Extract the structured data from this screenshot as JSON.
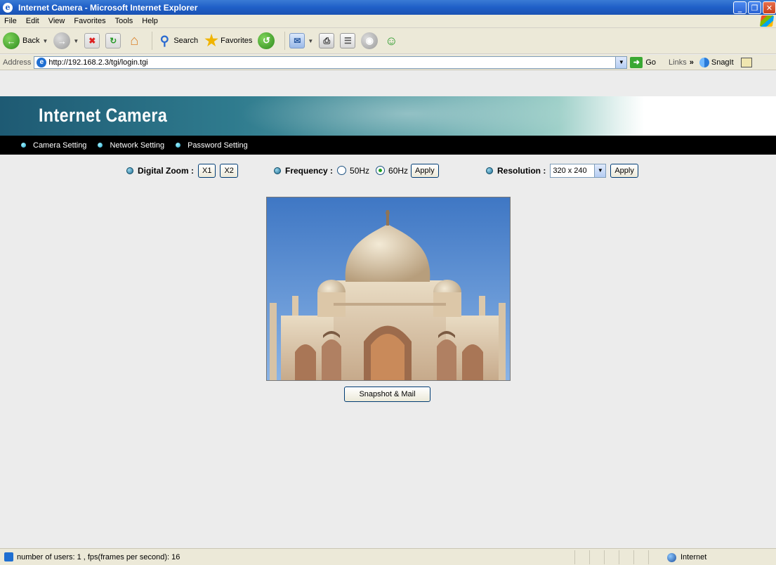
{
  "window": {
    "title": "Internet Camera - Microsoft Internet Explorer",
    "buttons": [
      "_",
      "❐",
      "✕"
    ]
  },
  "menu": [
    "File",
    "Edit",
    "View",
    "Favorites",
    "Tools",
    "Help"
  ],
  "toolbar": {
    "back_label": "Back",
    "search_label": "Search",
    "favorites_label": "Favorites"
  },
  "address": {
    "label": "Address",
    "url": "http://192.168.2.3/tgi/login.tgi",
    "go_label": "Go",
    "links_label": "Links",
    "snagit_label": "SnagIt"
  },
  "banner": {
    "title": "Internet Camera"
  },
  "nav": [
    "Camera Setting",
    "Network Setting",
    "Password Setting"
  ],
  "controls": {
    "digital_zoom_label": "Digital Zoom :",
    "zoom_buttons": [
      "X1",
      "X2"
    ],
    "frequency_label": "Frequency :",
    "frequency_options": [
      "50Hz",
      "60Hz"
    ],
    "frequency_selected": "60Hz",
    "apply_label": "Apply",
    "resolution_label": "Resolution :",
    "resolution_value": "320 x 240"
  },
  "snapshot_button": "Snapshot & Mail",
  "status": {
    "text": "number of users: 1  ,  fps(frames per second): 16",
    "zone": "Internet"
  },
  "colors": {
    "title_bar": "#2060c8",
    "nav_bar": "#000000",
    "banner": "#2f7b8e"
  }
}
